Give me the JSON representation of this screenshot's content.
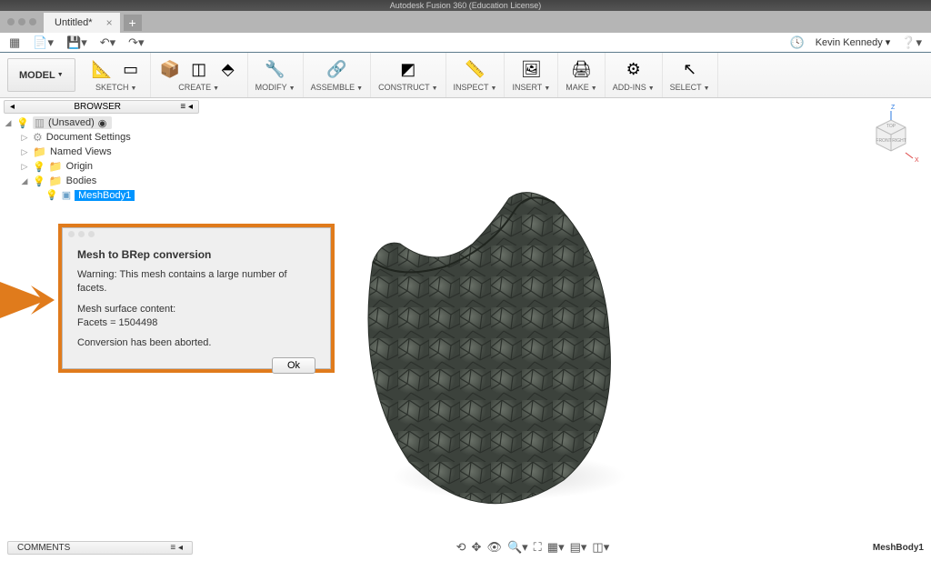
{
  "titlebar": "Autodesk Fusion 360 (Education License)",
  "tab": {
    "label": "Untitled*"
  },
  "qat": {
    "user": "Kevin Kennedy"
  },
  "ribbon": {
    "model": "MODEL",
    "sketch": "SKETCH",
    "create": "CREATE",
    "modify": "MODIFY",
    "assemble": "ASSEMBLE",
    "construct": "CONSTRUCT",
    "inspect": "INSPECT",
    "insert": "INSERT",
    "make": "MAKE",
    "addins": "ADD-INS",
    "select": "SELECT"
  },
  "browser": {
    "header": "BROWSER",
    "root": "(Unsaved)",
    "docset": "Document Settings",
    "views": "Named Views",
    "origin": "Origin",
    "bodies": "Bodies",
    "meshbody": "MeshBody1"
  },
  "dialog": {
    "title": "Mesh to BRep conversion",
    "warning": "Warning: This mesh contains a large number of facets.",
    "content_label": "Mesh surface content:",
    "facets": "Facets = 1504498",
    "aborted": "Conversion has been aborted.",
    "ok": "Ok"
  },
  "viewcube": {
    "top": "TOP",
    "front": "FRONT",
    "right": "RIGHT"
  },
  "footer": {
    "comments": "COMMENTS",
    "selection": "MeshBody1"
  }
}
